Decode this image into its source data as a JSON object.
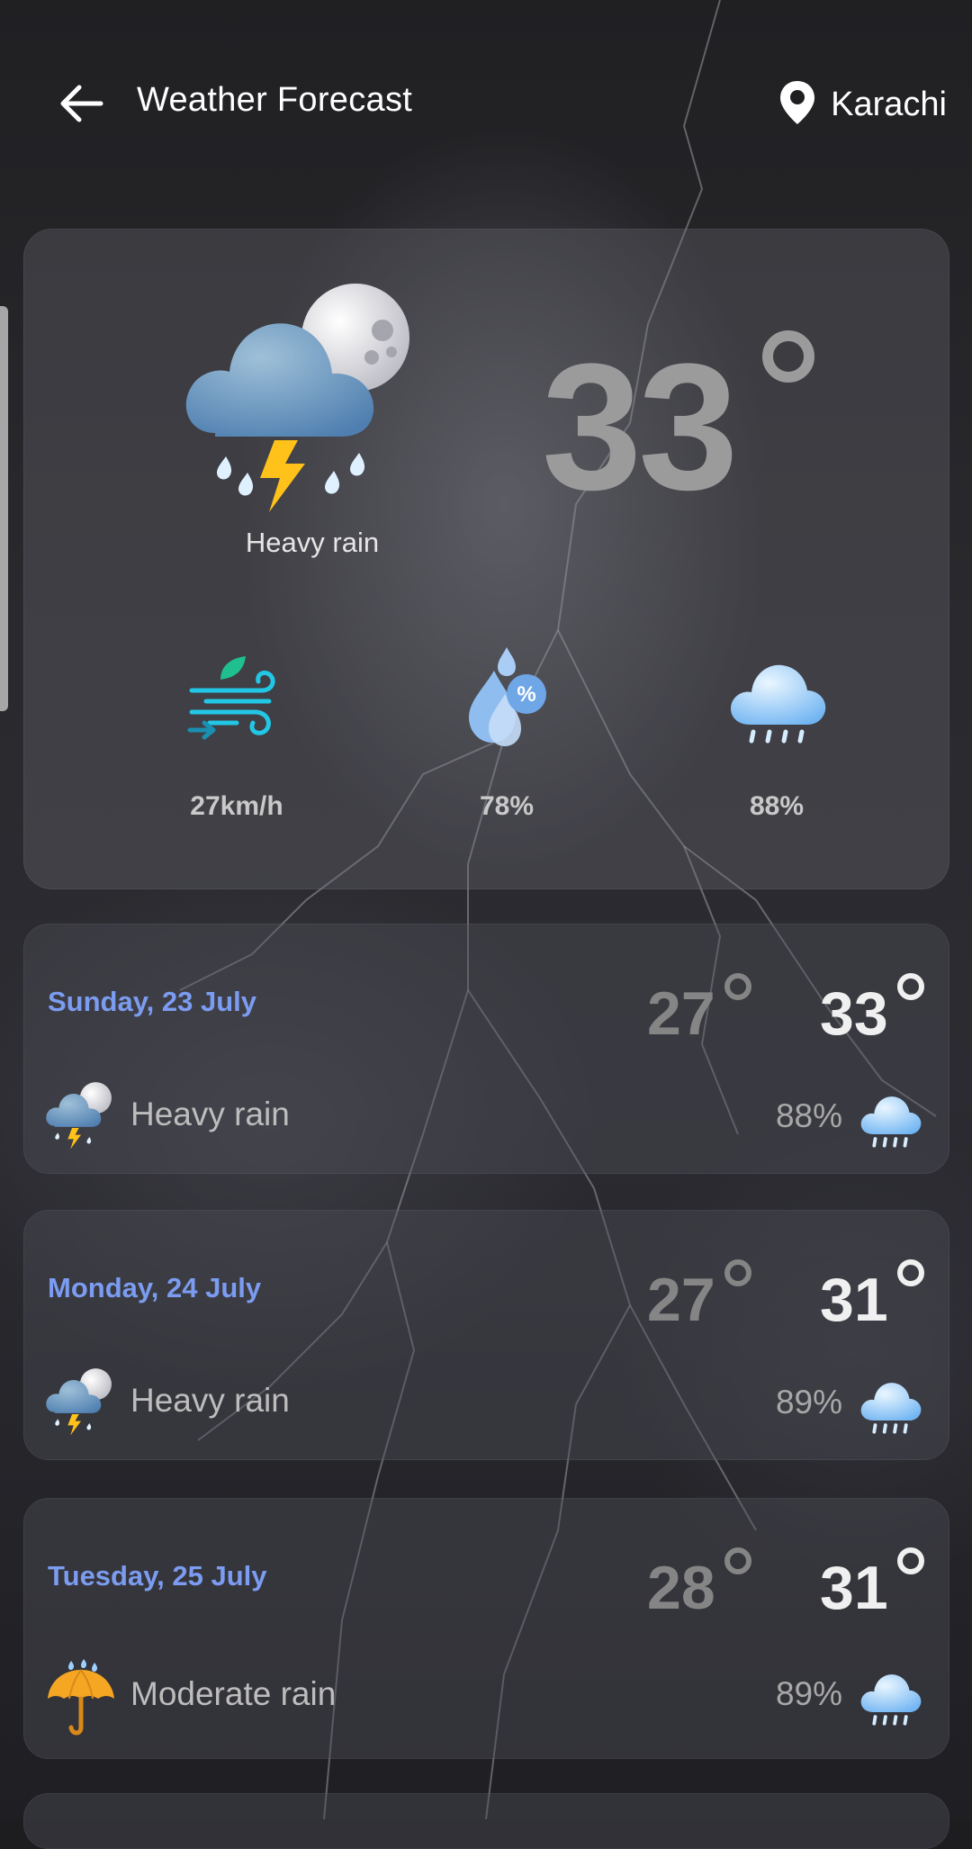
{
  "header": {
    "title": "Weather Forecast",
    "location": "Karachi",
    "back_icon": "arrow-left-icon",
    "location_icon": "map-pin-icon"
  },
  "current": {
    "condition": "Heavy rain",
    "icon": "cloud-moon-thunder-rain-icon",
    "temperature": "33",
    "stats": [
      {
        "name": "wind",
        "icon": "wind-icon",
        "value": "27km/h"
      },
      {
        "name": "humidity",
        "icon": "humidity-drop-icon",
        "value": "78%"
      },
      {
        "name": "precipitation",
        "icon": "rain-cloud-icon",
        "value": "88%"
      }
    ]
  },
  "forecast": [
    {
      "date": "Sunday, 23 July",
      "low": "27",
      "high": "33",
      "condition": "Heavy rain",
      "icon": "cloud-moon-thunder-rain-icon",
      "precipitation": "88%"
    },
    {
      "date": "Monday, 24 July",
      "low": "27",
      "high": "31",
      "condition": "Heavy rain",
      "icon": "cloud-moon-thunder-rain-icon",
      "precipitation": "89%"
    },
    {
      "date": "Tuesday, 25 July",
      "low": "28",
      "high": "31",
      "condition": "Moderate rain",
      "icon": "umbrella-rain-icon",
      "precipitation": "89%"
    }
  ],
  "colors": {
    "date_accent": "#7b9cf0",
    "high_temp": "#f0f0f0",
    "low_temp": "#858585",
    "current_temp": "#9b9b9b"
  }
}
